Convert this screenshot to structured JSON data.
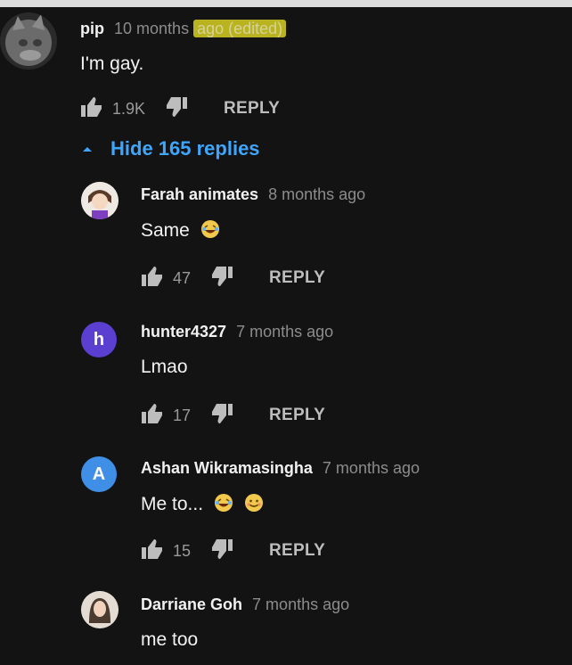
{
  "colors": {
    "background": "#131313",
    "link_blue": "#3ea6ff",
    "highlight": "#b9b31f",
    "avatar_h": "#5b3fd0",
    "avatar_a": "#3f8fe6"
  },
  "labels": {
    "reply": "REPLY",
    "hide_replies": "Hide 165 replies"
  },
  "top_comment": {
    "author": "pip",
    "time_prefix": "10 months",
    "time_highlighted": "ago (edited)",
    "text": "I'm gay.",
    "likes": "1.9K",
    "avatar_icon": "blurred-cat-avatar"
  },
  "replies": [
    {
      "author": "Farah animates",
      "time": "8 months ago",
      "text": "Same",
      "emojis": [
        "laughing-emoji"
      ],
      "likes": "47",
      "avatar_icon": "cartoon-avatar"
    },
    {
      "author": "hunter4327",
      "time": "7 months ago",
      "text": "Lmao",
      "emojis": [],
      "likes": "17",
      "avatar_letter": "h"
    },
    {
      "author": "Ashan Wikramasingha",
      "time": "7 months ago",
      "text": "Me to...",
      "emojis": [
        "laughing-emoji",
        "smiling-emoji"
      ],
      "likes": "15",
      "avatar_letter": "A"
    },
    {
      "author": "Darriane Goh",
      "time": "7 months ago",
      "text": "me too",
      "emojis": [],
      "likes": "",
      "avatar_icon": "photo-avatar"
    }
  ]
}
